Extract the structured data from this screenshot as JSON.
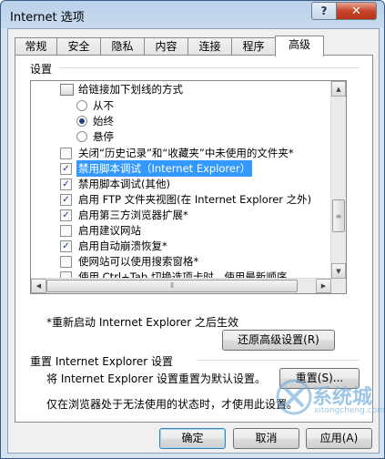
{
  "window": {
    "title": "Internet 选项",
    "help_label": "?",
    "close_label": "✕"
  },
  "tabs": [
    {
      "label": "常规"
    },
    {
      "label": "安全"
    },
    {
      "label": "隐私"
    },
    {
      "label": "内容"
    },
    {
      "label": "连接"
    },
    {
      "label": "程序"
    },
    {
      "label": "高级",
      "active": true
    }
  ],
  "settings": {
    "group_label": "设置",
    "items": [
      {
        "kind": "category",
        "label": "给链接加下划线的方式"
      },
      {
        "kind": "radio",
        "label": "从不",
        "checked": false
      },
      {
        "kind": "radio",
        "label": "始终",
        "checked": true
      },
      {
        "kind": "radio",
        "label": "悬停",
        "checked": false
      },
      {
        "kind": "checkbox",
        "label": "关闭“历史记录”和“收藏夹”中未使用的文件夹*",
        "checked": false
      },
      {
        "kind": "checkbox",
        "label": "禁用脚本调试（Internet Explorer）",
        "checked": true,
        "selected": true
      },
      {
        "kind": "checkbox",
        "label": "禁用脚本调试(其他)",
        "checked": true
      },
      {
        "kind": "checkbox",
        "label": "启用 FTP 文件夹视图(在 Internet Explorer 之外)",
        "checked": true
      },
      {
        "kind": "checkbox",
        "label": "启用第三方浏览器扩展*",
        "checked": true
      },
      {
        "kind": "checkbox",
        "label": "启用建议网站",
        "checked": false
      },
      {
        "kind": "checkbox",
        "label": "启用自动崩溃恢复*",
        "checked": true
      },
      {
        "kind": "checkbox",
        "label": "使网站可以使用搜索窗格*",
        "checked": false
      },
      {
        "kind": "checkbox",
        "label": "使用 Ctrl+Tab 切换选项卡时，使用最新顺序",
        "checked": false
      }
    ],
    "restart_note": "*重新启动 Internet Explorer 之后生效",
    "restore_button": "还原高级设置(R)"
  },
  "reset": {
    "group_label": "重置 Internet Explorer 设置",
    "description": "将 Internet Explorer 设置重置为默认设置。",
    "reset_button": "重置(S)...",
    "warning": "仅在浏览器处于无法使用的状态时，才使用此设置。"
  },
  "footer": {
    "ok": "确定",
    "cancel": "取消",
    "apply": "应用(A)"
  },
  "watermark": {
    "text": "系统城",
    "subtext": "xitongcheng.com"
  }
}
